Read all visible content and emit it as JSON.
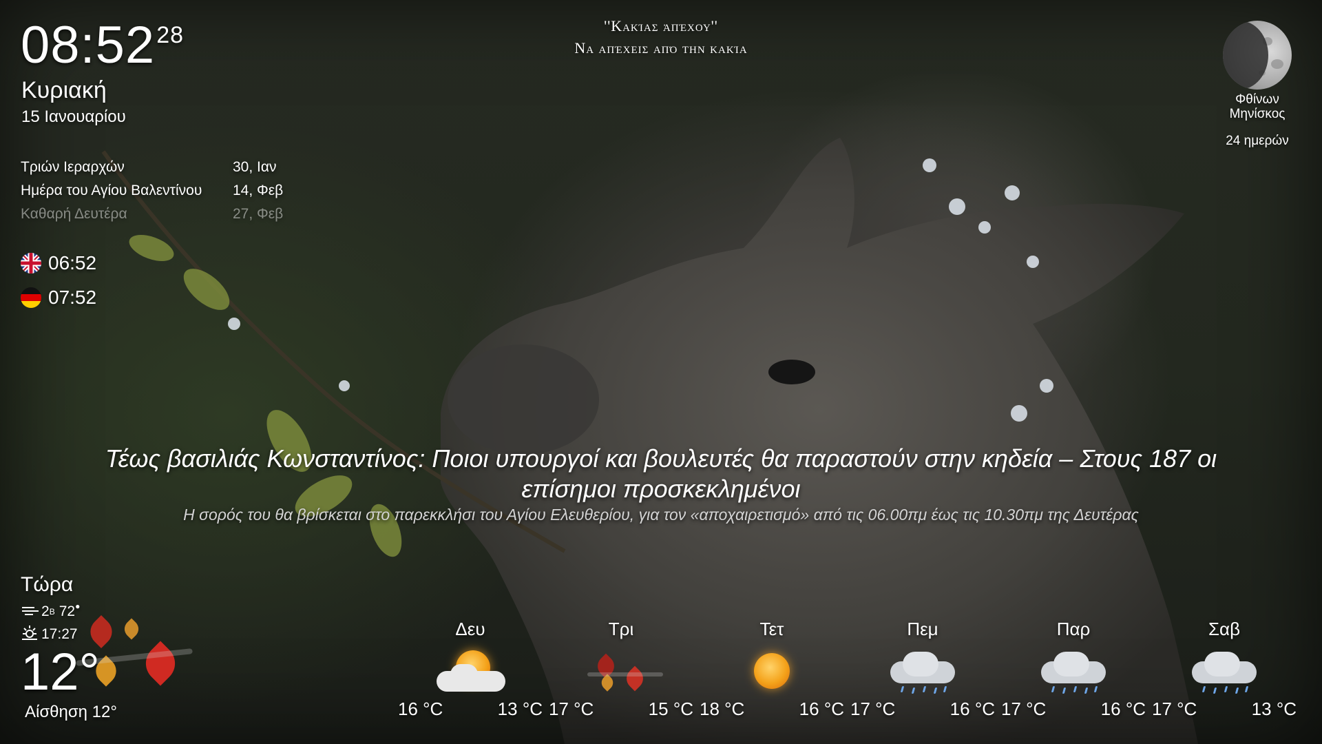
{
  "clock": {
    "time": "08:52",
    "seconds": "28",
    "day_name": "Κυριακή",
    "date": "15 Ιανουαρίου"
  },
  "holidays": [
    {
      "name": "Τριών Ιεραρχών",
      "date": "30, Ιαν"
    },
    {
      "name": "Ημέρα του Αγίου Βαλεντίνου",
      "date": "14, Φεβ"
    },
    {
      "name": "Καθαρή Δευτέρα",
      "date": "27, Φεβ"
    }
  ],
  "world_clocks": [
    {
      "flag": "uk-flag-icon",
      "time": "06:52"
    },
    {
      "flag": "germany-flag-icon",
      "time": "07:52"
    }
  ],
  "quote": {
    "line1": "''Κακίας ἀπέχου''",
    "line2": "Να απέχεις από την κακία"
  },
  "moon": {
    "phase_line1": "Φθίνων",
    "phase_line2": "Μηνίσκος",
    "days": "24 ημερών"
  },
  "news": {
    "headline": "Τέως βασιλιάς Κωνσταντίνος: Ποιοι υπουργοί και βουλευτές θα παραστούν στην κηδεία – Στους 187 οι επίσημοι προσκεκλημένοι",
    "subheadline": "Η σορός του θα βρίσκεται στο παρεκκλήσι του Αγίου Ελευθερίου, για τον «αποχαιρετισμό» από τις 06.00πμ έως τις 10.30πμ της Δευτέρας"
  },
  "current_weather": {
    "label": "Τώρα",
    "wind": "2",
    "wind_unit": "B",
    "humidity": "72",
    "sunset": "17:27",
    "temperature": "12°",
    "feels_like": "Αίσθηση 12°",
    "icon": "autumn-leaves-wind-icon"
  },
  "forecast": [
    {
      "day": "Δευ",
      "icon": "partly-sunny-icon",
      "high": "16 °C",
      "low": "13 °C"
    },
    {
      "day": "Τρι",
      "icon": "windy-leaves-icon",
      "high": "17 °C",
      "low": "15 °C"
    },
    {
      "day": "Τετ",
      "icon": "sun-icon",
      "high": "18 °C",
      "low": "16 °C"
    },
    {
      "day": "Πεμ",
      "icon": "rain-cloud-icon",
      "high": "17 °C",
      "low": "16 °C"
    },
    {
      "day": "Παρ",
      "icon": "rain-cloud-icon",
      "high": "17 °C",
      "low": "16 °C"
    },
    {
      "day": "Σαβ",
      "icon": "rain-cloud-icon",
      "high": "17 °C",
      "low": "13 °C"
    }
  ],
  "colors": {
    "text": "#ffffff",
    "sun": "#f4a21a",
    "leaf_red": "#c8251f",
    "leaf_orange": "#d9861c"
  }
}
